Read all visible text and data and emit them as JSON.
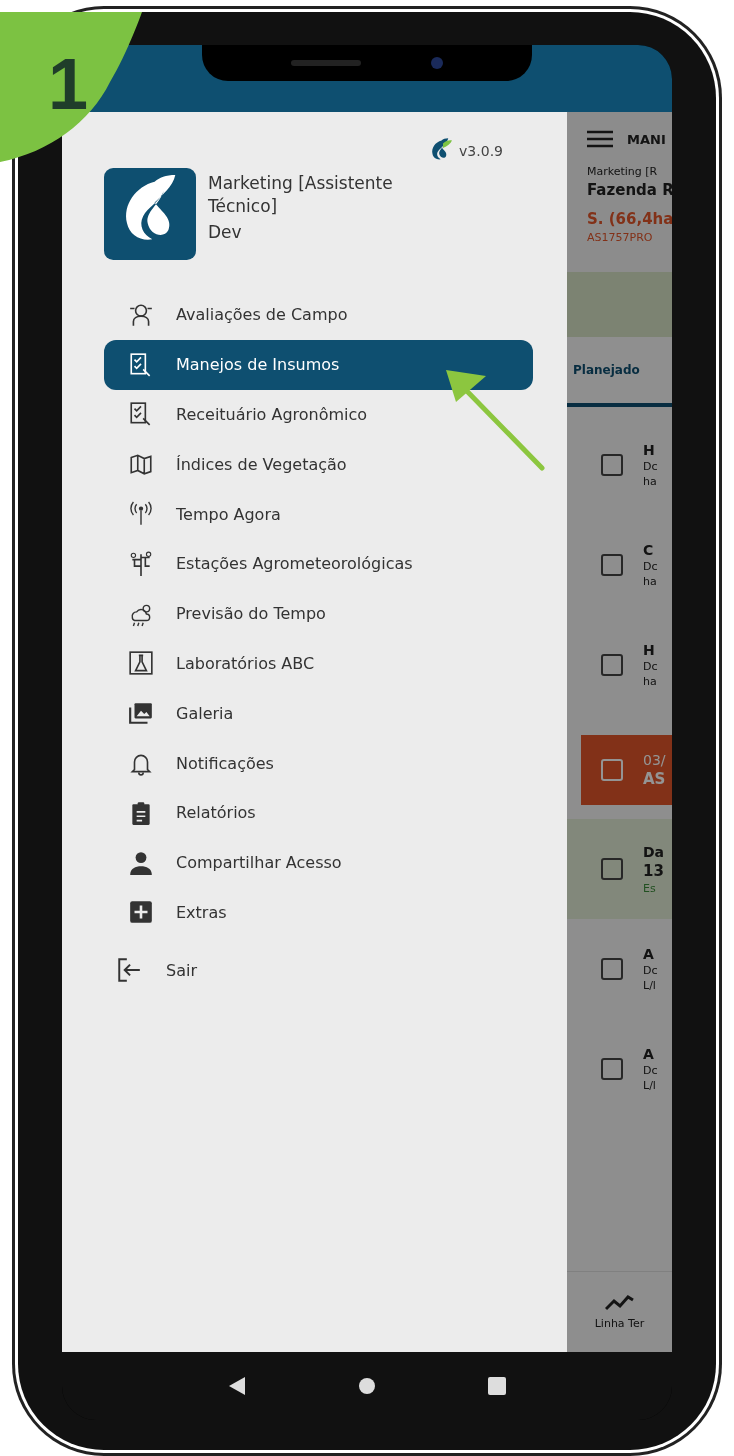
{
  "step_badge": "1",
  "drawer": {
    "version": "v3.0.9",
    "profile": {
      "name": "Marketing [Assistente Técnico]",
      "environment": "Dev"
    },
    "items": [
      {
        "label": "Avaliações de Campo",
        "selected": false
      },
      {
        "label": "Manejos de Insumos",
        "selected": true
      },
      {
        "label": "Receituário Agronômico",
        "selected": false
      },
      {
        "label": "Índices de Vegetação",
        "selected": false
      },
      {
        "label": "Tempo Agora",
        "selected": false
      },
      {
        "label": "Estações Agrometeorológicas",
        "selected": false
      },
      {
        "label": "Previsão do Tempo",
        "selected": false
      },
      {
        "label": "Laboratórios ABC",
        "selected": false
      },
      {
        "label": "Galeria",
        "selected": false
      },
      {
        "label": "Notificações",
        "selected": false
      },
      {
        "label": "Relatórios",
        "selected": false
      },
      {
        "label": "Compartilhar Acesso",
        "selected": false
      },
      {
        "label": "Extras",
        "selected": false
      }
    ],
    "logout": "Sair"
  },
  "background_screen": {
    "title": "MANI",
    "user": "Marketing [R",
    "farm": "Fazenda R",
    "field": "S. (66,4ha",
    "code": "AS1757PRO",
    "tab": "Planejado",
    "rows": [
      {
        "kind": "plain",
        "title": "H",
        "lines": [
          "Dc",
          "ha"
        ],
        "checked": false
      },
      {
        "kind": "plain",
        "title": "C",
        "lines": [
          "Dc",
          "ha"
        ],
        "checked": false
      },
      {
        "kind": "plain",
        "title": "H",
        "lines": [
          "Dc",
          "ha"
        ],
        "checked": false
      },
      {
        "kind": "alert",
        "title": "03/",
        "lines": [
          "AS"
        ],
        "checked": false
      },
      {
        "kind": "done",
        "title": "Da",
        "lines": [
          "13",
          "Es"
        ],
        "checked": false
      },
      {
        "kind": "plain",
        "title": "A",
        "lines": [
          "Dc",
          "L/l"
        ],
        "checked": false
      },
      {
        "kind": "plain",
        "title": "A",
        "lines": [
          "Dc",
          "L/l"
        ],
        "checked": false
      }
    ],
    "bottom_tab": "Linha Ter"
  }
}
